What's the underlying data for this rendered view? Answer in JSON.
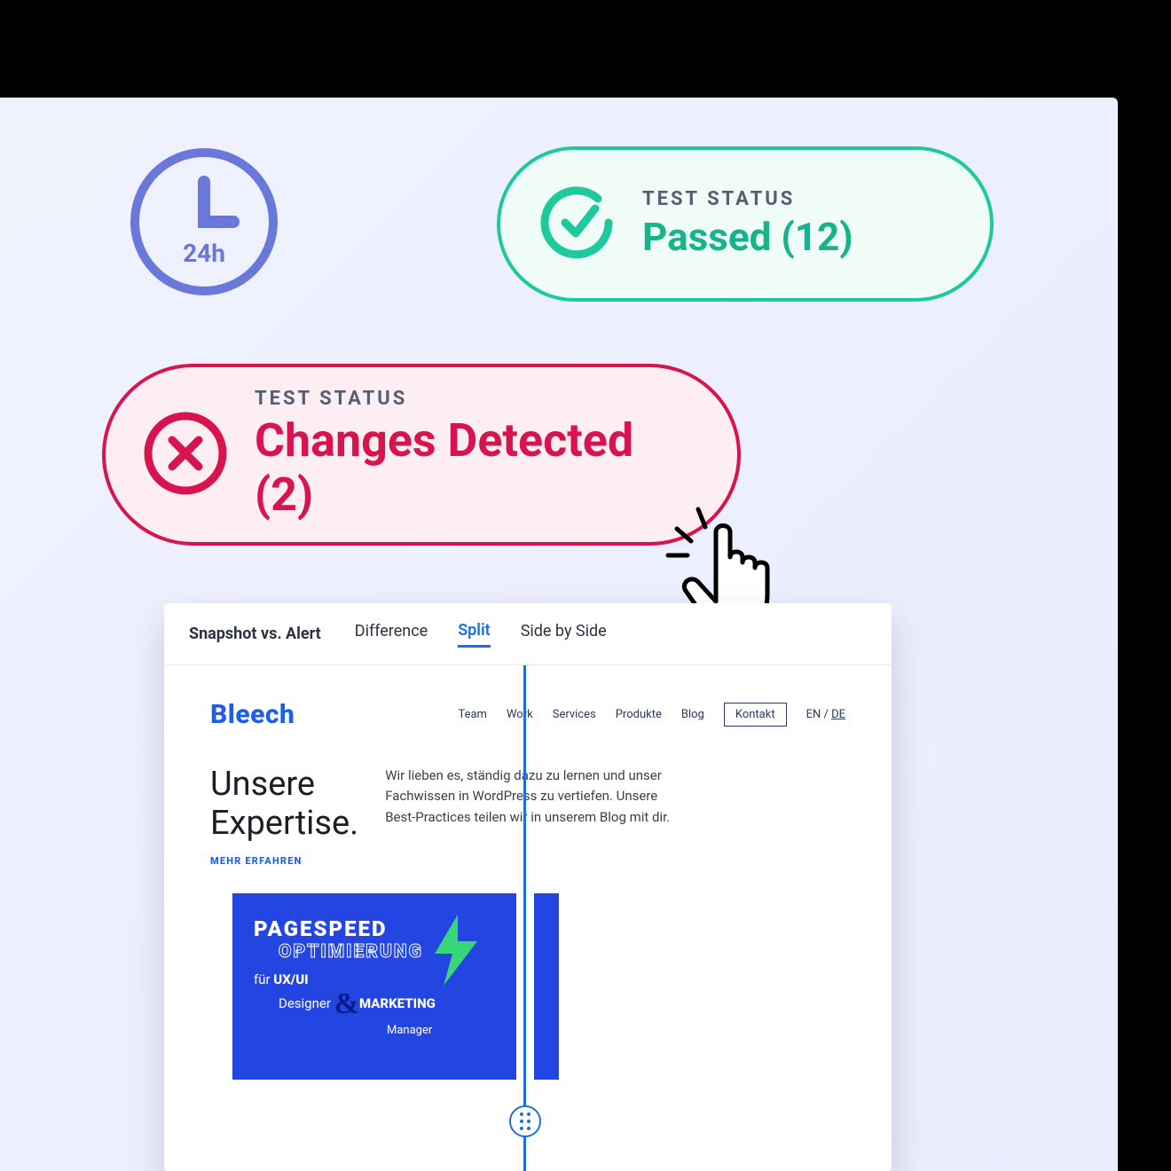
{
  "clock": {
    "label": "24h"
  },
  "status_passed": {
    "label": "TEST STATUS",
    "value": "Passed (12)"
  },
  "status_changes": {
    "label": "TEST STATUS",
    "value": "Changes Detected (2)"
  },
  "panel": {
    "title": "Snapshot vs. Alert",
    "tabs": {
      "difference": "Difference",
      "split": "Split",
      "side_by_side": "Side by Side"
    }
  },
  "site": {
    "brand": "Bleech",
    "nav": {
      "team": "Team",
      "work": "Work",
      "services": "Services",
      "produkte": "Produkte",
      "blog": "Blog",
      "kontakt": "Kontakt",
      "lang_en": "EN / ",
      "lang_de": "DE"
    },
    "hero": {
      "title_l1": "Unsere",
      "title_l2": "Expertise.",
      "more": "MEHR ERFAHREN",
      "body": "Wir lieben es, ständig dazu zu lernen und unser Fachwissen in WordPress zu vertiefen. Unsere Best-Practices teilen wir in unserem Blog mit dir."
    },
    "card": {
      "l1": "PAGESPEED",
      "l2": "OPTIMIERUNG",
      "l3_pre": "für ",
      "l3_ux": "UX/UI",
      "l3_designer": "Designer",
      "l3_marketing": "MARKETING",
      "l3_manager": "Manager"
    }
  }
}
